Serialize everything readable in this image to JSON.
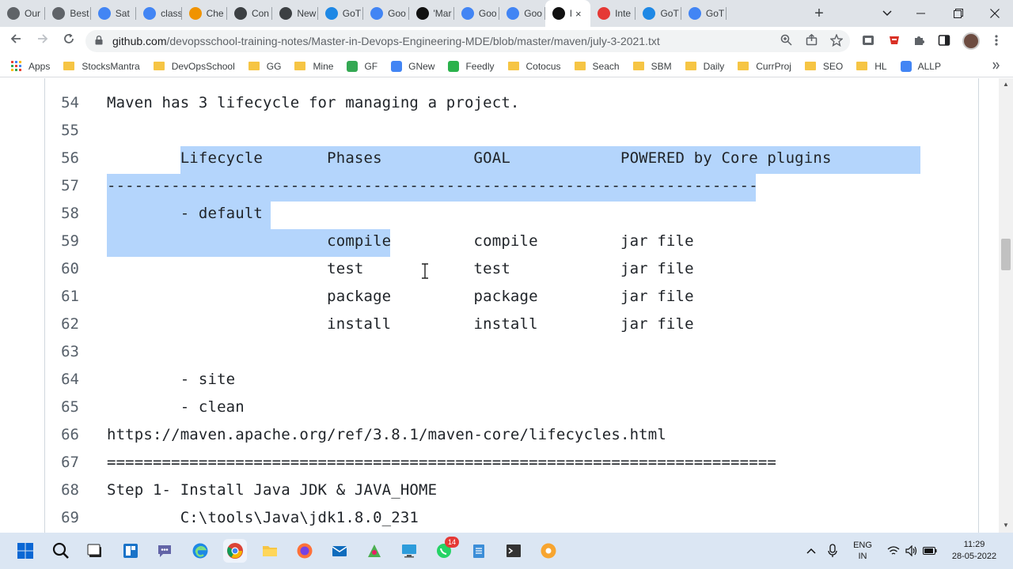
{
  "browser": {
    "tabs": [
      {
        "label": "Our",
        "icon": "clock-icon",
        "color": "#5f6368"
      },
      {
        "label": "Best",
        "icon": "clock-icon",
        "color": "#5f6368"
      },
      {
        "label": "Sat",
        "icon": "google-icon",
        "color": "#4285f4"
      },
      {
        "label": "class",
        "icon": "google-icon",
        "color": "#4285f4"
      },
      {
        "label": "Che",
        "icon": "chef-icon",
        "color": "#f09300"
      },
      {
        "label": "Con",
        "icon": "people-icon",
        "color": "#3c4043"
      },
      {
        "label": "New",
        "icon": "chrome-icon",
        "color": "#3c4043"
      },
      {
        "label": "GoT",
        "icon": "xm-icon",
        "color": "#1e88e5"
      },
      {
        "label": "Goo",
        "icon": "gsheets-icon",
        "color": "#4285f4"
      },
      {
        "label": "'Mar",
        "icon": "medium-icon",
        "color": "#111111"
      },
      {
        "label": "Goo",
        "icon": "gsheets-icon",
        "color": "#4285f4"
      },
      {
        "label": "Goo",
        "icon": "gsheets-icon",
        "color": "#4285f4"
      },
      {
        "label": "I",
        "icon": "github-icon",
        "color": "#111111",
        "active": true
      },
      {
        "label": "Inte",
        "icon": "gauge-icon",
        "color": "#e53935"
      },
      {
        "label": "GoT",
        "icon": "xm-icon",
        "color": "#1e88e5"
      },
      {
        "label": "GoT",
        "icon": "google-icon",
        "color": "#4285f4"
      }
    ],
    "close_glyph": "×",
    "new_tab_glyph": "+",
    "url_host": "github.com",
    "url_path": "/devopsschool-training-notes/Master-in-Devops-Engineering-MDE/blob/master/maven/july-3-2021.txt"
  },
  "bookmarks": [
    {
      "label": "Apps",
      "icon": "apps-grid-icon"
    },
    {
      "label": "StocksMantra",
      "icon": "folder-icon"
    },
    {
      "label": "DevOpsSchool",
      "icon": "folder-icon"
    },
    {
      "label": "GG",
      "icon": "folder-icon"
    },
    {
      "label": "Mine",
      "icon": "folder-icon"
    },
    {
      "label": "GF",
      "icon": "gf-icon"
    },
    {
      "label": "GNew",
      "icon": "gnews-icon"
    },
    {
      "label": "Feedly",
      "icon": "feedly-icon"
    },
    {
      "label": "Cotocus",
      "icon": "folder-icon"
    },
    {
      "label": "Seach",
      "icon": "folder-icon"
    },
    {
      "label": "SBM",
      "icon": "folder-icon"
    },
    {
      "label": "Daily",
      "icon": "folder-icon"
    },
    {
      "label": "CurrProj",
      "icon": "folder-icon"
    },
    {
      "label": "SEO",
      "icon": "folder-icon"
    },
    {
      "label": "HL",
      "icon": "folder-icon"
    },
    {
      "label": "ALLP",
      "icon": "doc-icon"
    }
  ],
  "file_lines": [
    {
      "num": "54",
      "text": "Maven has 3 lifecycle for managing a project."
    },
    {
      "num": "55",
      "text": ""
    },
    {
      "num": "56",
      "text": "        Lifecycle       Phases          GOAL            POWERED by Core plugins"
    },
    {
      "num": "57",
      "text": "-----------------------------------------------------------------------"
    },
    {
      "num": "58",
      "text": "        - default"
    },
    {
      "num": "59",
      "text": "                        compile         compile         jar file"
    },
    {
      "num": "60",
      "text": "                        test            test            jar file"
    },
    {
      "num": "61",
      "text": "                        package         package         jar file"
    },
    {
      "num": "62",
      "text": "                        install         install         jar file"
    },
    {
      "num": "63",
      "text": ""
    },
    {
      "num": "64",
      "text": "        - site"
    },
    {
      "num": "65",
      "text": "        - clean"
    },
    {
      "num": "66",
      "text": "https://maven.apache.org/ref/3.8.1/maven-core/lifecycles.html"
    },
    {
      "num": "67",
      "text": "========================================================================="
    },
    {
      "num": "68",
      "text": "Step 1- Install Java JDK & JAVA_HOME"
    },
    {
      "num": "69",
      "text": "        C:\\tools\\Java\\jdk1.8.0_231"
    }
  ],
  "taskbar": {
    "language_line1": "ENG",
    "language_line2": "IN",
    "time": "11:29",
    "date": "28-05-2022",
    "whatsapp_badge": "14"
  }
}
